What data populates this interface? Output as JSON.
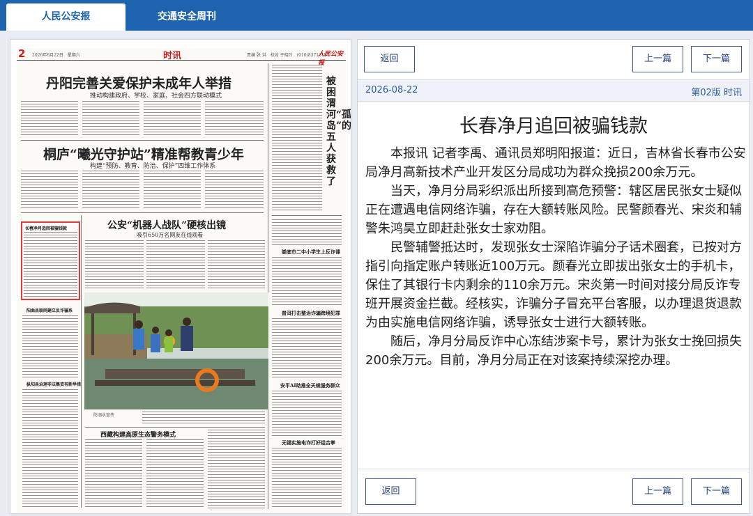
{
  "tabs": [
    {
      "label": "人民公安报",
      "active": true
    },
    {
      "label": "交通安全周刊",
      "active": false
    }
  ],
  "newspaper": {
    "page_number": "2",
    "date_line": "2026年8月22日　星期六",
    "section": "时讯",
    "right_info": "责编 张 洪　校对 于晓玲　(010)83713187",
    "logo": "人民公安报",
    "headline_1": "丹阳完善关爱保护未成年人举措",
    "subhead_1": "推动构建政府、学校、家庭、社会四方联动模式",
    "headline_2": "桐庐“曦光守护站”精准帮教青少年",
    "subhead_2": "构建“预防、教育、防治、保护”四维工作体系",
    "vertical_title": "被困渭河“孤岛”的五人获救了",
    "headline_3": "公安“机器人战队”硬核出镜",
    "subhead_3": "吸引650万名网友在线观看",
    "headline_4": "西藏构建高原生态警务模式",
    "photo_caption": "防溺水宣传",
    "small_heads": [
      "长春净月追回被骗钱款",
      "阳曲县联网建立反诈骗系",
      "娄底市二中小学生上反诈课",
      "普洱打击整治诈骗跨境犯罪",
      "安平AI助推全天候服务群众",
      "无锡实施电诈打好组合拳",
      "枞阳县治理非法集资有新举措"
    ]
  },
  "article": {
    "back_label": "返回",
    "prev_label": "上一篇",
    "next_label": "下一篇",
    "date": "2026-08-22",
    "page_info": "第02版 时讯",
    "title": "长春净月追回被骗钱款",
    "paragraphs": [
      "本报讯 记者李禹、通讯员郑明阳报道：近日，吉林省长春市公安局净月高新技术产业开发区分局成功为群众挽损200余万元。",
      "当天，净月分局彩织派出所接到高危预警：辖区居民张女士疑似正在遭遇电信网络诈骗，存在大额转账风险。民警颜春光、宋炎和辅警朱鸿昊立即赶赴张女士家劝阻。",
      "民警辅警抵达时，发现张女士深陷诈骗分子话术圈套，已按对方指引向指定账户转账近100万元。颜春光立即拔出张女士的手机卡，保住了其银行卡内剩余的110余万元。宋炎第一时间对接分局反诈专班开展资金拦截。经核实，诈骗分子冒充平台客服，以办理退货退款为由实施电信网络诈骗，诱导张女士进行大额转账。",
      "随后，净月分局反诈中心冻结涉案卡号，累计为张女士挽回损失200余万元。目前，净月分局正在对该案持续深挖办理。"
    ]
  },
  "colors": {
    "brand_blue": "#1d63ad",
    "highlight_red": "#e03a3a",
    "link_blue": "#2c5aa0"
  }
}
